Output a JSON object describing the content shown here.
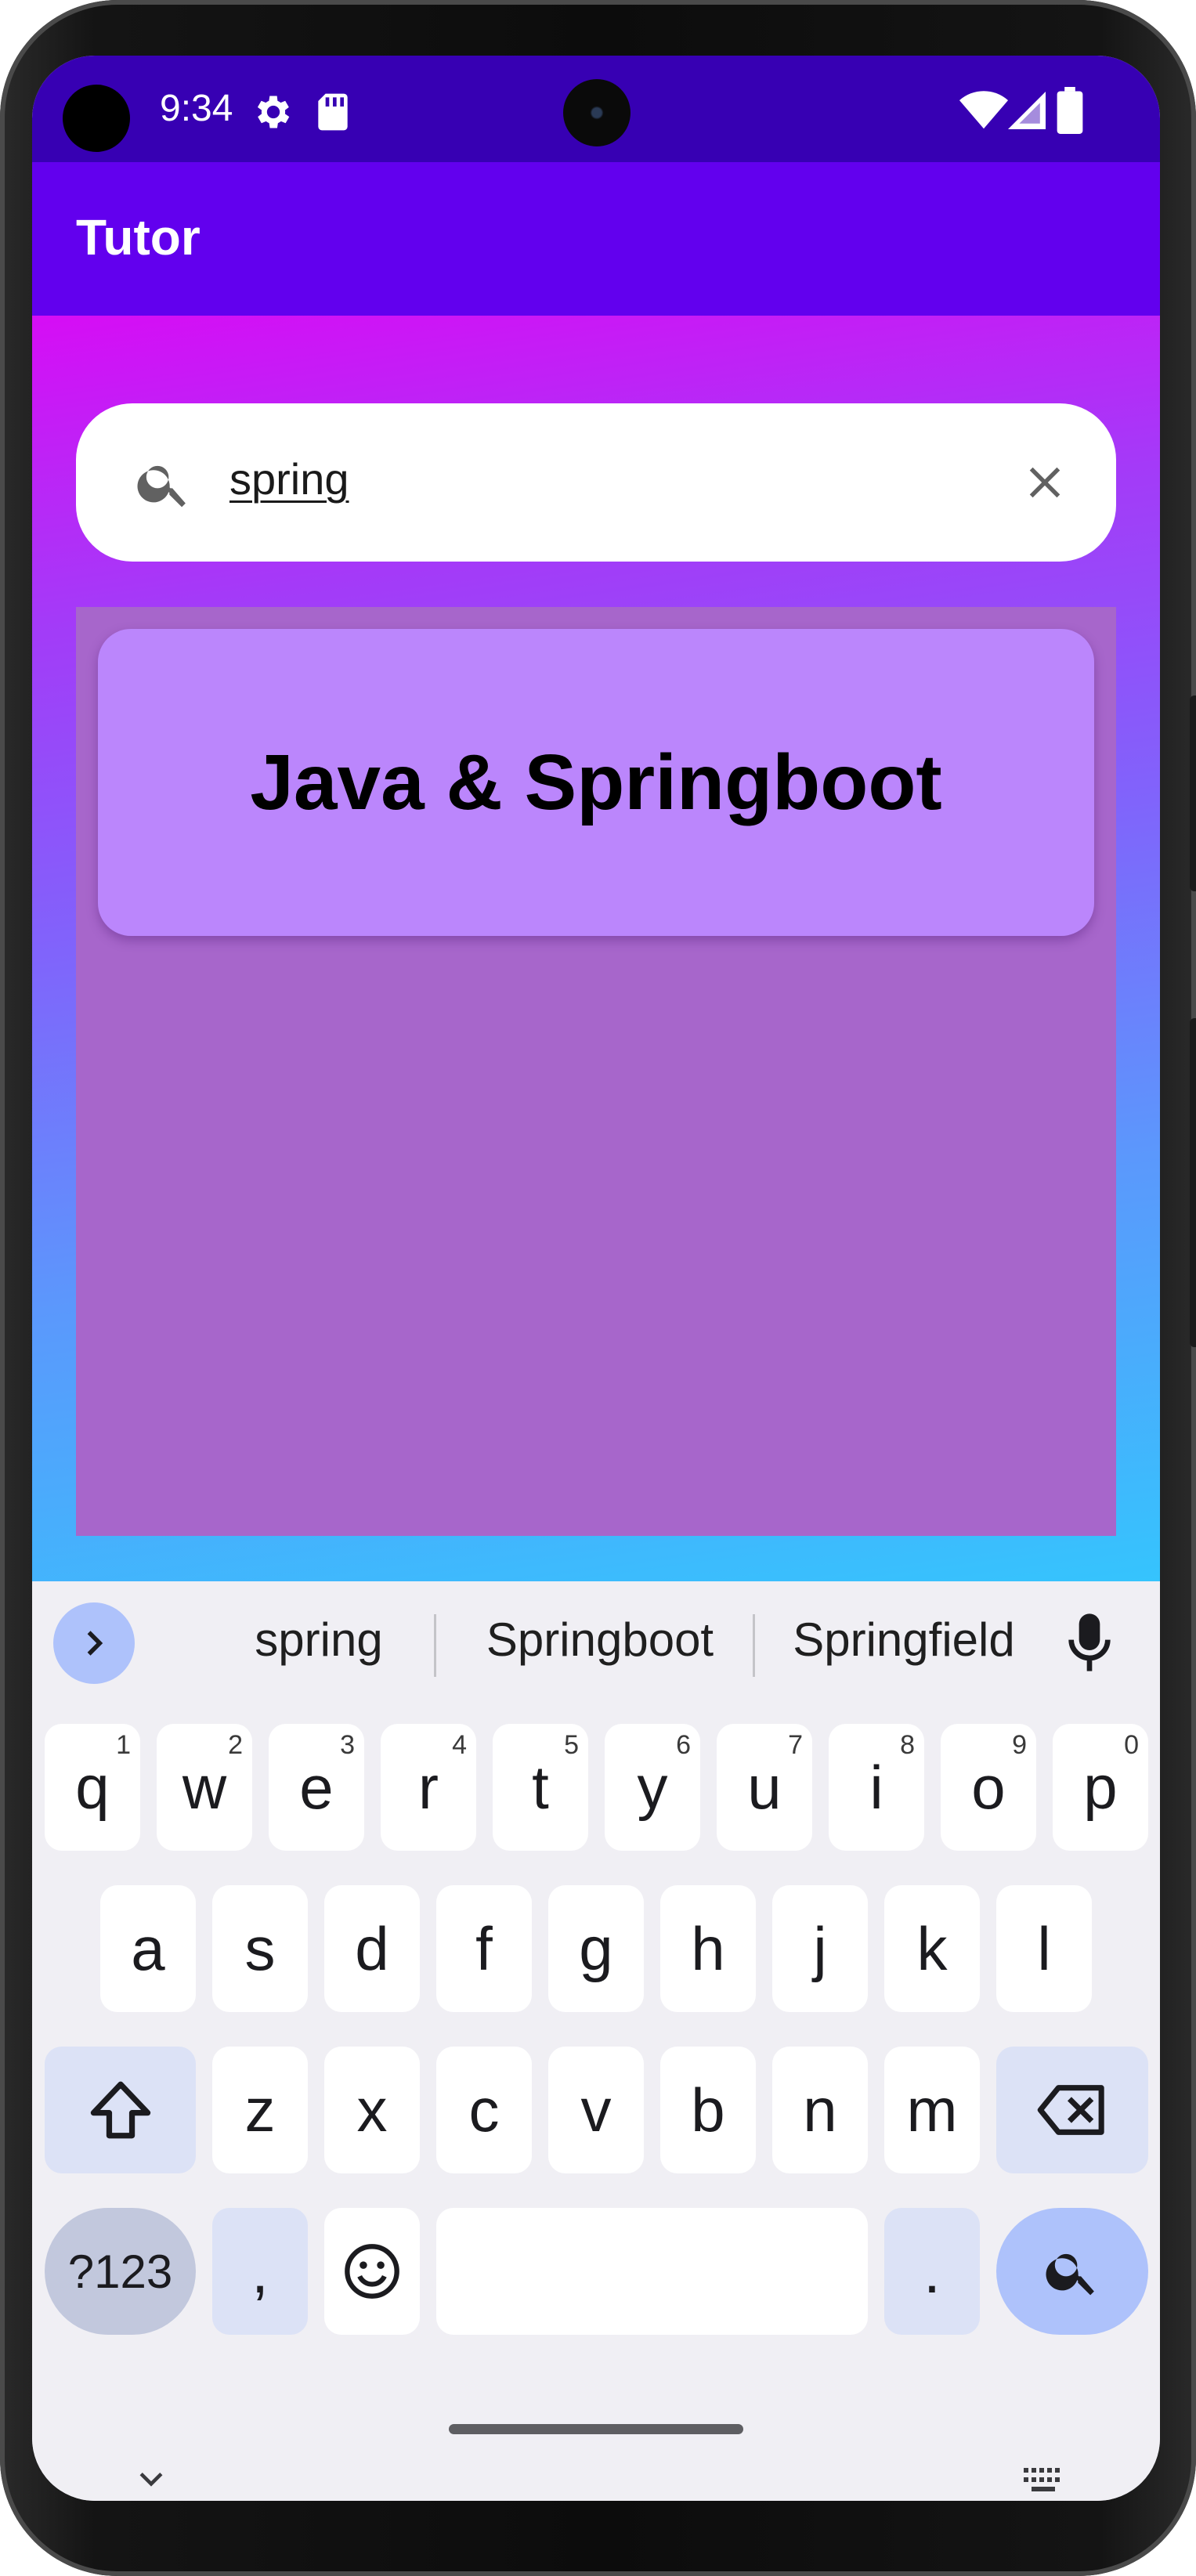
{
  "status_bar": {
    "time": "9:34",
    "icons": [
      "settings-icon",
      "sd-card-icon",
      "wifi-icon",
      "signal-icon",
      "battery-icon"
    ]
  },
  "app_bar": {
    "title": "Tutor",
    "color": "#6200ee"
  },
  "search": {
    "value": "spring",
    "search_icon": "search-icon",
    "clear_icon": "close-icon"
  },
  "results": [
    {
      "title": "Java & Springboot"
    }
  ],
  "keyboard": {
    "suggestions": [
      "spring",
      "Springboot",
      "Springfield"
    ],
    "rows": {
      "row1": [
        {
          "key": "q",
          "hint": "1"
        },
        {
          "key": "w",
          "hint": "2"
        },
        {
          "key": "e",
          "hint": "3"
        },
        {
          "key": "r",
          "hint": "4"
        },
        {
          "key": "t",
          "hint": "5"
        },
        {
          "key": "y",
          "hint": "6"
        },
        {
          "key": "u",
          "hint": "7"
        },
        {
          "key": "i",
          "hint": "8"
        },
        {
          "key": "o",
          "hint": "9"
        },
        {
          "key": "p",
          "hint": "0"
        }
      ],
      "row2": [
        "a",
        "s",
        "d",
        "f",
        "g",
        "h",
        "j",
        "k",
        "l"
      ],
      "row3": [
        "z",
        "x",
        "c",
        "v",
        "b",
        "n",
        "m"
      ],
      "row4": {
        "symbols": "?123",
        "comma": ",",
        "period": "."
      }
    },
    "icons": [
      "chevron-right-icon",
      "mic-icon",
      "shift-icon",
      "backspace-icon",
      "emoji-icon",
      "search-icon",
      "chevron-down-icon",
      "keyboard-icon"
    ]
  },
  "colors": {
    "status_bar": "#3700b3",
    "app_bar": "#6200ee",
    "card": "#bb86fc",
    "results_panel": "#a766cb",
    "gradient_top": "#d60df5",
    "gradient_bottom": "#35c4fd"
  }
}
